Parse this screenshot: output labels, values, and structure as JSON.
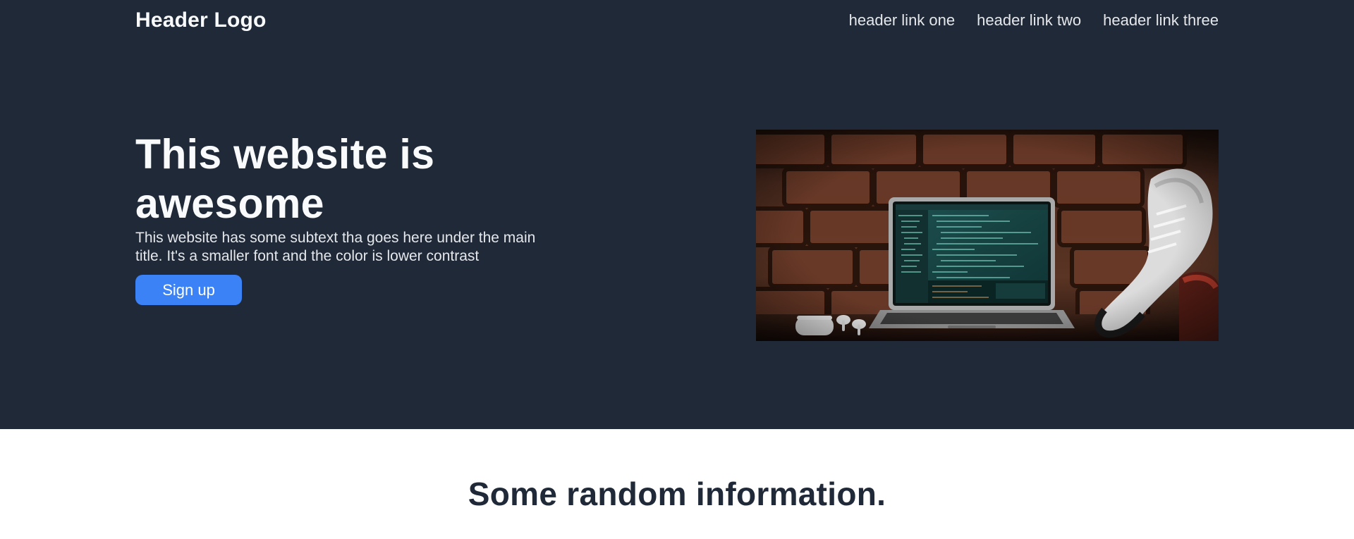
{
  "header": {
    "logo": "Header Logo",
    "nav_links": [
      "header link one",
      "header link two",
      "header link three"
    ]
  },
  "hero": {
    "title": "This website is awesome",
    "subtitle": "This website has some subtext tha goes here under the main title. It's a smaller font and the color is lower contrast",
    "button_label": "Sign up",
    "image_description": "laptop-on-brick-wall-photo"
  },
  "info": {
    "title": "Some random information."
  },
  "colors": {
    "hero_background": "#1f2937",
    "accent": "#3b82f6",
    "page_background": "#ffffff",
    "heading_dark": "#1f2937"
  }
}
